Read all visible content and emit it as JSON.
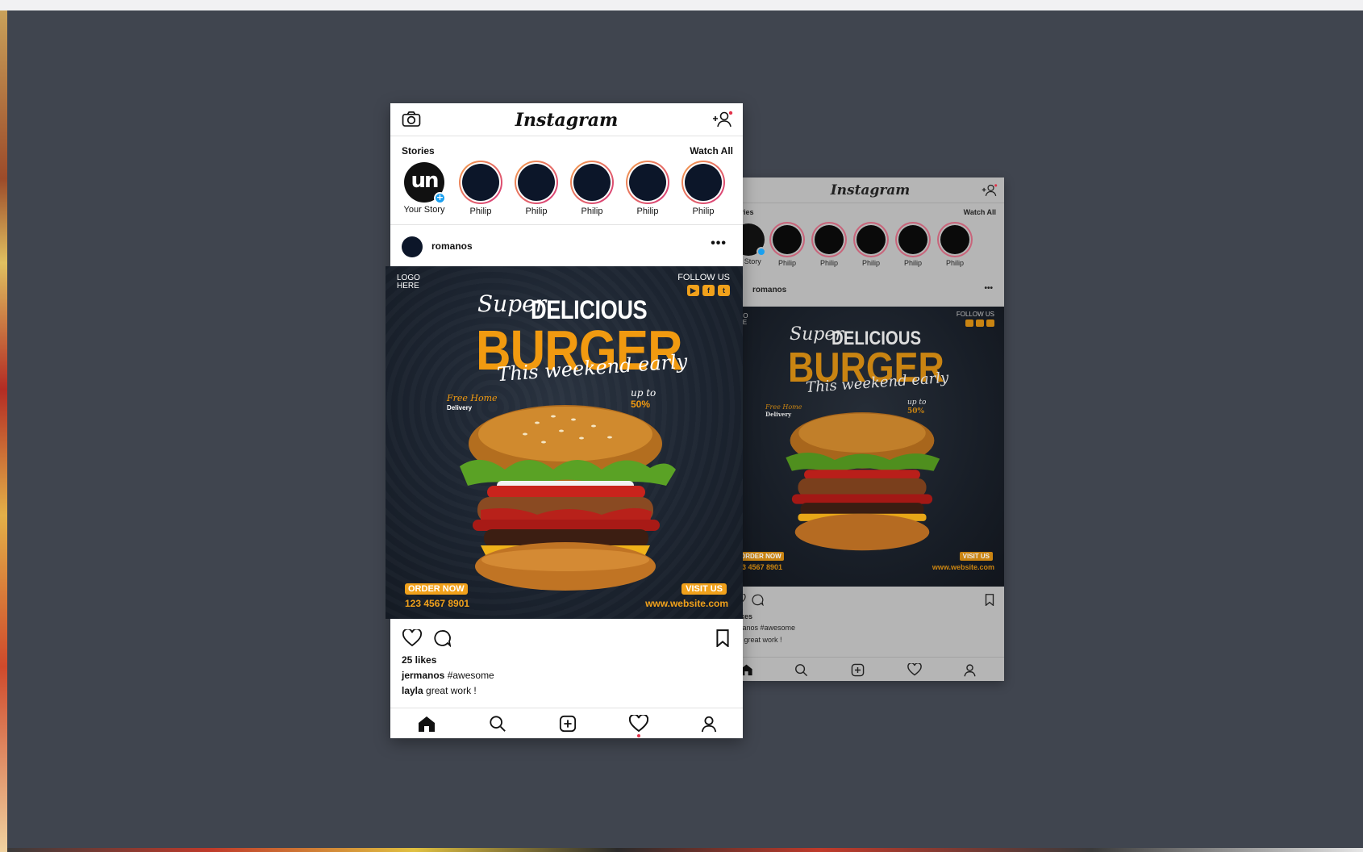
{
  "front": {
    "logo": "Instagram",
    "stories_label": "Stories",
    "watch_all": "Watch All",
    "your_story": {
      "avatar_text": "un",
      "name": "Your Story"
    },
    "stories": [
      "Philip",
      "Philip",
      "Philip",
      "Philip",
      "Philip"
    ],
    "post_user": "romanos",
    "more": "•••",
    "likes": "25 likes",
    "caption_user": "jermanos",
    "caption_text": "#awesome",
    "comment_user": "layla",
    "comment_text": "great work !"
  },
  "ad": {
    "logo_line1": "LOGO",
    "logo_line2": "HERE",
    "follow": "FOLLOW US",
    "super": "Super",
    "delicious": "DELICIOUS",
    "burger": "BURGER",
    "weekend": "This weekend early",
    "free_line1": "Free Home",
    "free_line2": "Delivery",
    "upto_line1": "up to",
    "upto_line2": "50%",
    "order_now": "ORDER NOW",
    "phone": "123 4567 8901",
    "visit_us": "VISIT US",
    "website": "www.website.com"
  },
  "back": {
    "logo": "Instagram",
    "stories_label": "ories",
    "watch_all": "Watch All",
    "your_story_name": "ur Story",
    "stories": [
      "Philip",
      "Philip",
      "Philip",
      "Philip",
      "Philip"
    ],
    "post_user": "romanos",
    "more": "•••",
    "follow": "FOLLOW US",
    "logo_line1": "GO",
    "logo_line2": "RE",
    "super": "Super",
    "delicious": "DELICIOUS",
    "burger": "BURGER",
    "weekend": "This weekend early",
    "free_line1": "Free Home",
    "free_line2": "Delivery",
    "upto_line1": "up to",
    "upto_line2": "50%",
    "order_now": "ORDER NOW",
    "phone": "23 4567 8901",
    "visit_us": "VISIT US",
    "website": "www.website.com",
    "likes": "likes",
    "caption": "manos #awesome",
    "comment": "la great work !"
  },
  "colors": {
    "background": "#40454f",
    "accent": "#f19a10",
    "story_ring": "#d6347a",
    "notification": "#e2324a",
    "badge": "#1aa0f0"
  }
}
